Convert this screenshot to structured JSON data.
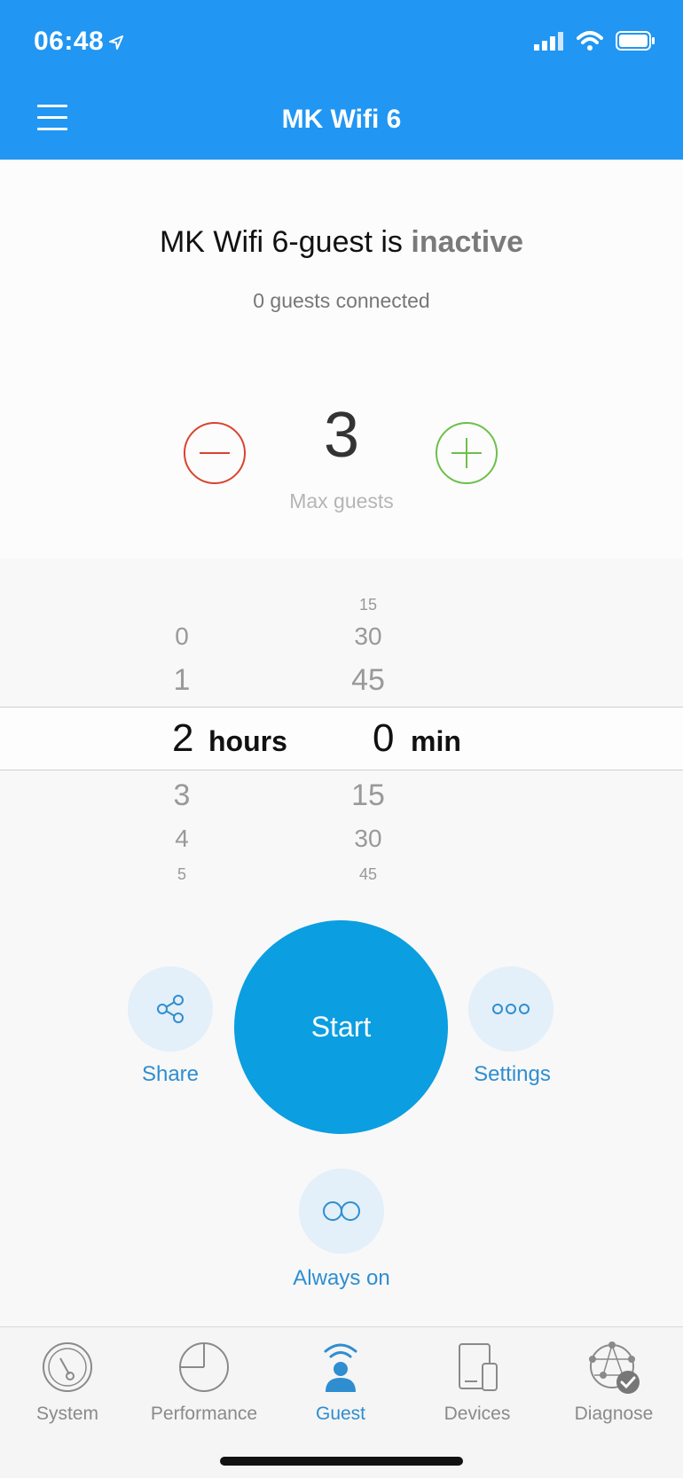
{
  "status_bar": {
    "time": "06:48"
  },
  "header": {
    "title": "MK Wifi 6"
  },
  "network": {
    "name": "MK Wifi 6-guest is",
    "state": "inactive",
    "guests_connected": "0 guests connected"
  },
  "max_guests": {
    "value": "3",
    "label": "Max guests"
  },
  "picker": {
    "hours": {
      "above": [
        "0",
        "1"
      ],
      "selected": "2",
      "unit": "hours",
      "below": [
        "3",
        "4",
        "5"
      ]
    },
    "minutes": {
      "above": [
        "15",
        "30",
        "45"
      ],
      "selected": "0",
      "unit": "min",
      "below": [
        "15",
        "30",
        "45"
      ]
    }
  },
  "actions": {
    "start": "Start",
    "share": "Share",
    "settings": "Settings",
    "always_on": "Always on"
  },
  "tabs": [
    {
      "label": "System",
      "icon": "gauge-icon"
    },
    {
      "label": "Performance",
      "icon": "pie-icon"
    },
    {
      "label": "Guest",
      "icon": "guest-icon",
      "active": true
    },
    {
      "label": "Devices",
      "icon": "devices-icon"
    },
    {
      "label": "Diagnose",
      "icon": "diagnose-icon"
    }
  ],
  "colors": {
    "header": "#2196f3",
    "start": "#0b9ee0",
    "minus": "#d9432f",
    "plus": "#6cc04a",
    "accent": "#2e8ed0"
  }
}
